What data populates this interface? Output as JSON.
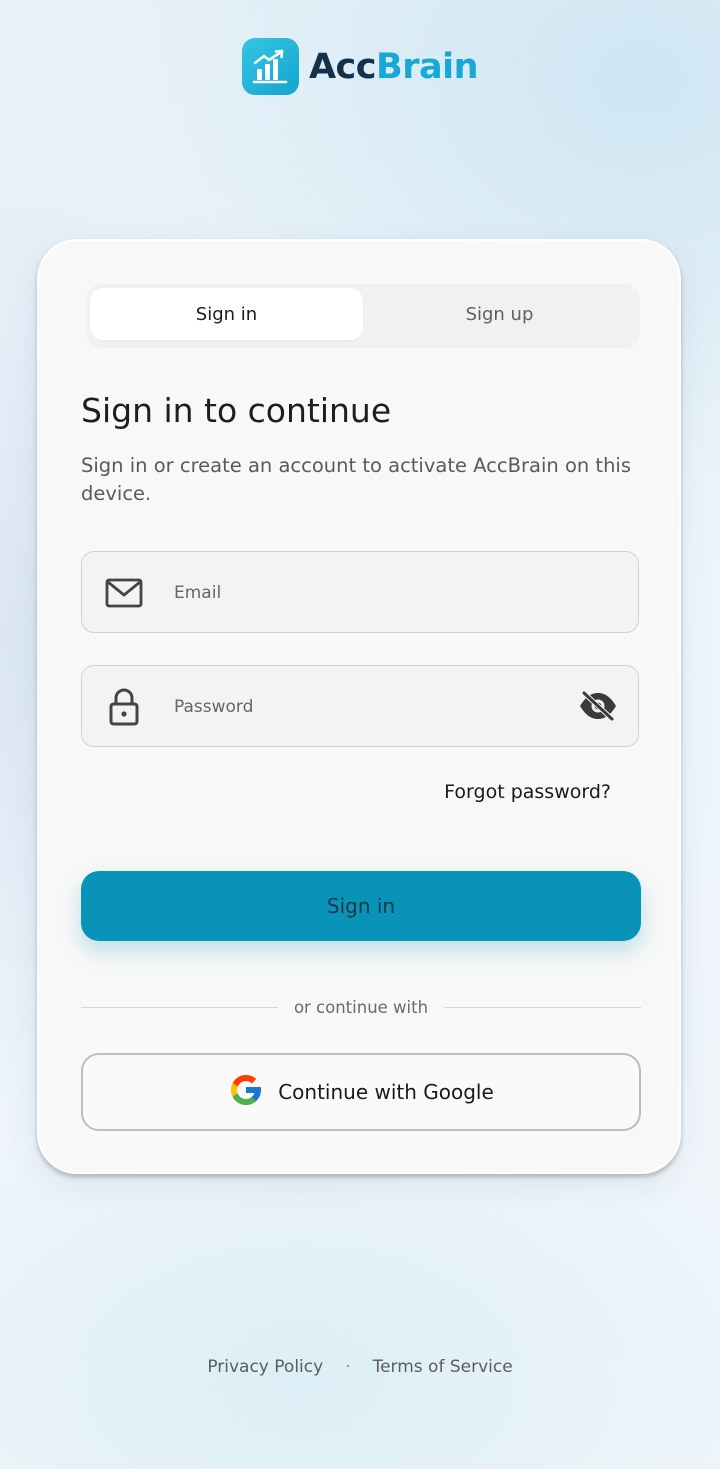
{
  "brand": {
    "name_part1": "Acc",
    "name_part2": "Brain",
    "logo_icon": "bar-chart-growth-icon",
    "accent_color": "#16a8d6",
    "dark_color": "#13324a"
  },
  "auth": {
    "tabs": [
      {
        "label": "Sign in",
        "active": true
      },
      {
        "label": "Sign up",
        "active": false
      }
    ],
    "title": "Sign in to continue",
    "subtitle": "Sign in or create an account to activate AccBrain on this device.",
    "email": {
      "placeholder": "Email",
      "value": "",
      "icon": "mail-icon"
    },
    "password": {
      "placeholder": "Password",
      "value": "",
      "icon": "lock-icon",
      "toggle_icon": "eye-off-icon"
    },
    "forgot_password": "Forgot password?",
    "primary_button": "Sign in",
    "primary_color": "#0a93b8",
    "divider_text": "or continue with",
    "google_button": "Continue with Google"
  },
  "footer": {
    "privacy": "Privacy Policy",
    "separator": "·",
    "terms": "Terms of Service"
  }
}
